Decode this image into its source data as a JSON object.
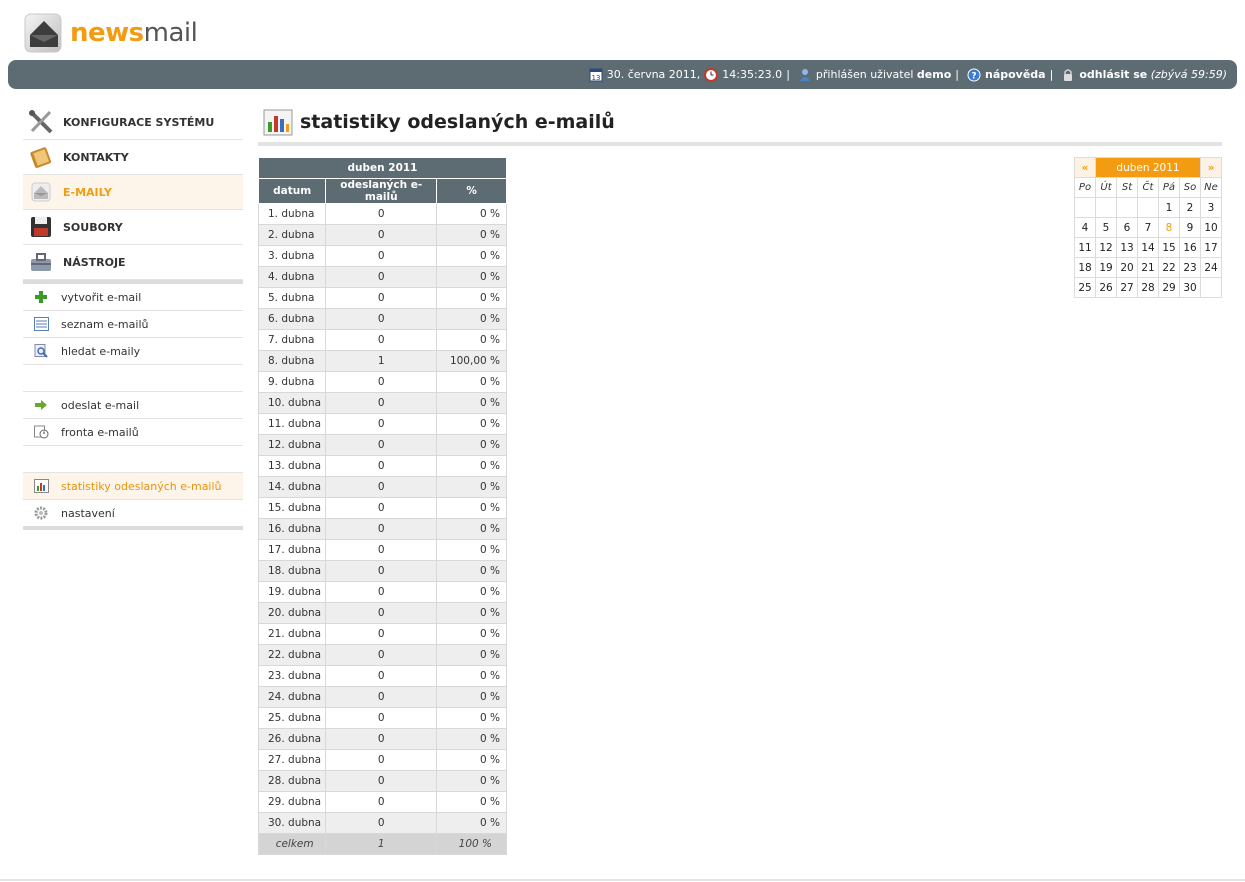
{
  "logo": {
    "part1": "news",
    "part2": "mail"
  },
  "topbar": {
    "date": "30. června 2011,",
    "time": "14:35:23.0",
    "sep": "|",
    "logged_prefix": "přihlášen uživatel",
    "user": "demo",
    "help": "nápověda",
    "logout": "odhlásit se",
    "remaining": "(zbývá 59:59)"
  },
  "mainnav": [
    {
      "label": "KONFIGURACE SYSTÉMU",
      "icon": "tools-icon"
    },
    {
      "label": "KONTAKTY",
      "icon": "address-book-icon"
    },
    {
      "label": "E-MAILY",
      "icon": "envelope-icon"
    },
    {
      "label": "SOUBORY",
      "icon": "floppy-disk-icon"
    },
    {
      "label": "NÁSTROJE",
      "icon": "toolbox-icon"
    }
  ],
  "subnav": {
    "create": "vytvořit e-mail",
    "list": "seznam e-mailů",
    "search": "hledat e-maily",
    "send": "odeslat e-mail",
    "queue": "fronta e-mailů",
    "stats": "statistiky odeslaných e-mailů",
    "settings": "nastavení"
  },
  "page": {
    "title": "statistiky odeslaných e-mailů"
  },
  "stats": {
    "month": "duben 2011",
    "headers": [
      "datum",
      "odeslaných e-mailů",
      "%"
    ],
    "rows": [
      [
        "1. dubna",
        "0",
        "0 %"
      ],
      [
        "2. dubna",
        "0",
        "0 %"
      ],
      [
        "3. dubna",
        "0",
        "0 %"
      ],
      [
        "4. dubna",
        "0",
        "0 %"
      ],
      [
        "5. dubna",
        "0",
        "0 %"
      ],
      [
        "6. dubna",
        "0",
        "0 %"
      ],
      [
        "7. dubna",
        "0",
        "0 %"
      ],
      [
        "8. dubna",
        "1",
        "100,00 %"
      ],
      [
        "9. dubna",
        "0",
        "0 %"
      ],
      [
        "10. dubna",
        "0",
        "0 %"
      ],
      [
        "11. dubna",
        "0",
        "0 %"
      ],
      [
        "12. dubna",
        "0",
        "0 %"
      ],
      [
        "13. dubna",
        "0",
        "0 %"
      ],
      [
        "14. dubna",
        "0",
        "0 %"
      ],
      [
        "15. dubna",
        "0",
        "0 %"
      ],
      [
        "16. dubna",
        "0",
        "0 %"
      ],
      [
        "17. dubna",
        "0",
        "0 %"
      ],
      [
        "18. dubna",
        "0",
        "0 %"
      ],
      [
        "19. dubna",
        "0",
        "0 %"
      ],
      [
        "20. dubna",
        "0",
        "0 %"
      ],
      [
        "21. dubna",
        "0",
        "0 %"
      ],
      [
        "22. dubna",
        "0",
        "0 %"
      ],
      [
        "23. dubna",
        "0",
        "0 %"
      ],
      [
        "24. dubna",
        "0",
        "0 %"
      ],
      [
        "25. dubna",
        "0",
        "0 %"
      ],
      [
        "26. dubna",
        "0",
        "0 %"
      ],
      [
        "27. dubna",
        "0",
        "0 %"
      ],
      [
        "28. dubna",
        "0",
        "0 %"
      ],
      [
        "29. dubna",
        "0",
        "0 %"
      ],
      [
        "30. dubna",
        "0",
        "0 %"
      ]
    ],
    "total": [
      "celkem",
      "1",
      "100 %"
    ]
  },
  "calendar": {
    "prev": "«",
    "next": "»",
    "month": "duben 2011",
    "weekdays": [
      "Po",
      "Út",
      "St",
      "Čt",
      "Pá",
      "So",
      "Ne"
    ],
    "weeks": [
      [
        "",
        "",
        "",
        "",
        "1",
        "2",
        "3"
      ],
      [
        "4",
        "5",
        "6",
        "7",
        "8",
        "9",
        "10"
      ],
      [
        "11",
        "12",
        "13",
        "14",
        "15",
        "16",
        "17"
      ],
      [
        "18",
        "19",
        "20",
        "21",
        "22",
        "23",
        "24"
      ],
      [
        "25",
        "26",
        "27",
        "28",
        "29",
        "30",
        ""
      ]
    ],
    "highlight_day": "8",
    "accent": "#f39c12"
  },
  "colors": {
    "bar": "#5d6b73",
    "accent": "#f39c12",
    "active_bg": "#fdf5e9"
  }
}
